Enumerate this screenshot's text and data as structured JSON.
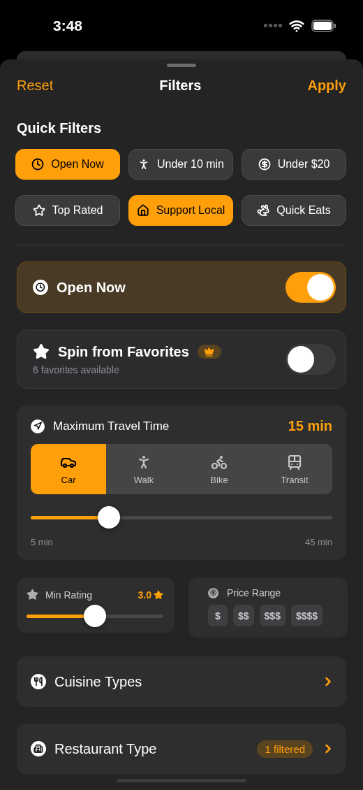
{
  "status_bar": {
    "time": "3:48"
  },
  "header": {
    "left": "Reset",
    "title": "Filters",
    "right": "Apply"
  },
  "quick_filters": {
    "title": "Quick Filters",
    "chips": [
      {
        "label": "Open Now",
        "selected": true
      },
      {
        "label": "Under 10 min",
        "selected": false
      },
      {
        "label": "Under $20",
        "selected": false
      },
      {
        "label": "Top Rated",
        "selected": false
      },
      {
        "label": "Support Local",
        "selected": true
      },
      {
        "label": "Quick Eats",
        "selected": false
      }
    ]
  },
  "toggles": [
    {
      "label": "Open Now",
      "on": true
    },
    {
      "label": "Spin from Favorites",
      "on": false,
      "premium": true,
      "subtitle": "6 favorites available"
    }
  ],
  "travel": {
    "title": "Maximum Travel Time",
    "value": "15 min",
    "modes": [
      {
        "label": "Car",
        "selected": true
      },
      {
        "label": "Walk",
        "selected": false
      },
      {
        "label": "Bike",
        "selected": false
      },
      {
        "label": "Transit",
        "selected": false
      }
    ],
    "level": 0.26,
    "min": "5 min",
    "max": "45 min"
  },
  "rating": {
    "title": "Min Rating",
    "value": "3.0",
    "level": 0.5
  },
  "price": {
    "title": "Price Range",
    "options": [
      {
        "label": "$",
        "selected": false
      },
      {
        "label": "$$",
        "selected": false
      },
      {
        "label": "$$$",
        "selected": false
      },
      {
        "label": "$$$$",
        "selected": false
      }
    ]
  },
  "nav_rows": [
    {
      "label": "Cuisine Types"
    },
    {
      "label": "Restaurant Type",
      "badge": "1 filtered"
    }
  ]
}
